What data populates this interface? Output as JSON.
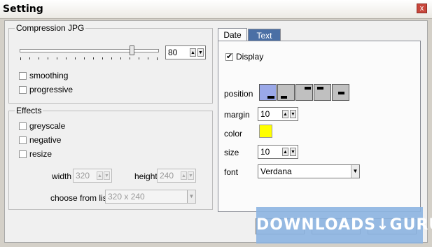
{
  "window": {
    "title": "Setting",
    "close_glyph": "x"
  },
  "compression": {
    "label": "Compression JPG",
    "quality_fraction": 0.8,
    "quality_value": "80",
    "options": [
      {
        "label": "smoothing",
        "checked": false
      },
      {
        "label": "progressive",
        "checked": false
      }
    ]
  },
  "effects": {
    "label": "Effects",
    "options": [
      {
        "label": "greyscale",
        "checked": false
      },
      {
        "label": "negative",
        "checked": false
      },
      {
        "label": "resize",
        "checked": false
      }
    ],
    "width_label": "width",
    "width_value": "320",
    "height_label": "height",
    "height_value": "240",
    "choose_label": "choose from list",
    "choose_value": "320 x 240"
  },
  "tabs": [
    {
      "label": "Date",
      "active": true
    },
    {
      "label": "Text",
      "active": false
    }
  ],
  "date_tab": {
    "display_label": "Display",
    "display_checked": true,
    "position_label": "position",
    "margin_label": "margin",
    "margin_value": "10",
    "color_label": "color",
    "color_value": "#ffff00",
    "size_label": "size",
    "size_value": "10",
    "font_label": "font",
    "font_value": "Verdana"
  },
  "watermark": {
    "text": "DOWNLOADS↓GURU"
  },
  "colors": {
    "accent": "#4a6fa5",
    "selected_position": "#9aa8e8",
    "titlebar": "#ffffff"
  }
}
